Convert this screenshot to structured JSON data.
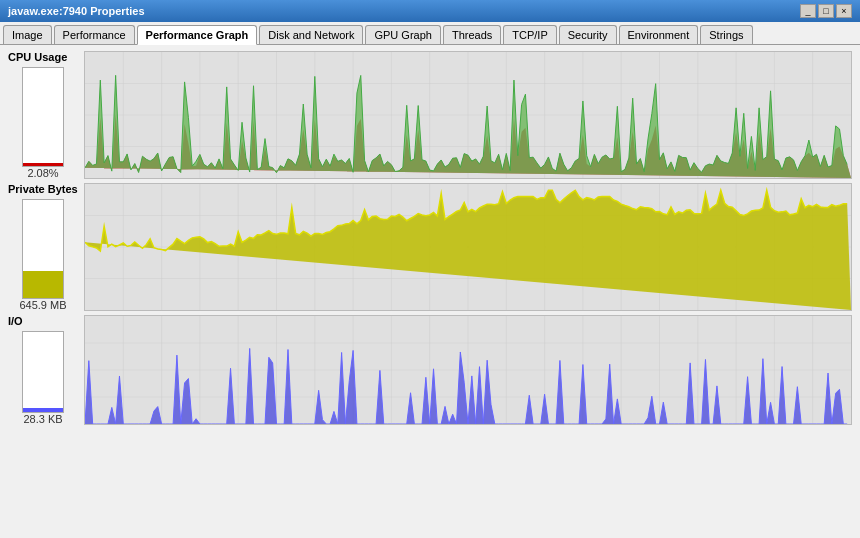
{
  "titleBar": {
    "title": "javaw.exe:7940 Properties",
    "buttons": [
      "_",
      "□",
      "×"
    ]
  },
  "tabs": [
    {
      "label": "Image",
      "active": false
    },
    {
      "label": "Performance",
      "active": false
    },
    {
      "label": "Performance Graph",
      "active": true
    },
    {
      "label": "Disk and Network",
      "active": false
    },
    {
      "label": "GPU Graph",
      "active": false
    },
    {
      "label": "Threads",
      "active": false
    },
    {
      "label": "TCP/IP",
      "active": false
    },
    {
      "label": "Security",
      "active": false
    },
    {
      "label": "Environment",
      "active": false
    },
    {
      "label": "Strings",
      "active": false
    }
  ],
  "charts": {
    "cpu": {
      "title": "CPU Usage",
      "value": "2.08%",
      "fillPercent": 3,
      "fillColor": "#cc0000"
    },
    "privateBytes": {
      "title": "Private Bytes",
      "value": "645.9 MB",
      "fillPercent": 28,
      "fillColor": "#b8b800"
    },
    "io": {
      "title": "I/O",
      "value": "28.3  KB",
      "fillPercent": 5,
      "fillColor": "#5555ff"
    }
  }
}
